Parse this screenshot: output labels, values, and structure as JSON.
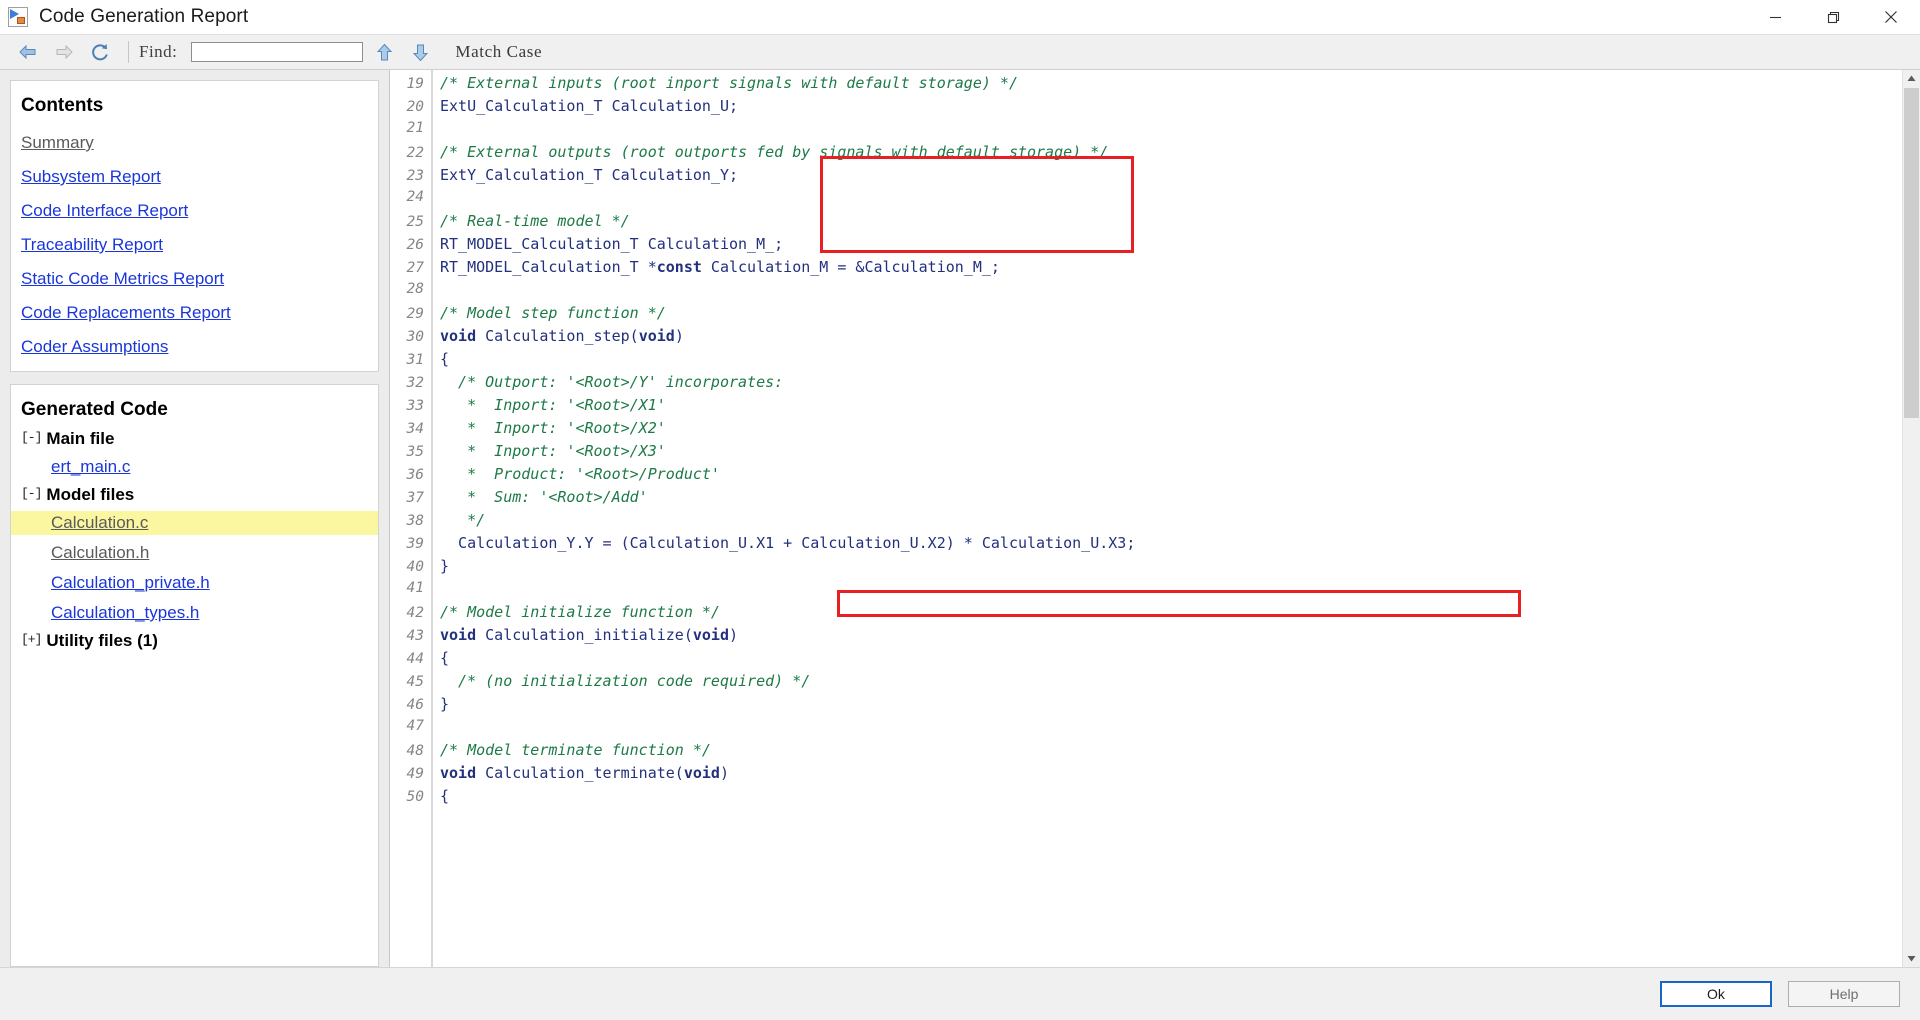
{
  "window": {
    "title": "Code Generation Report",
    "icon": "code-report-icon",
    "minimize_label": "Minimize",
    "restore_label": "Restore",
    "close_label": "Close"
  },
  "toolbar": {
    "back_label": "Back",
    "forward_label": "Forward",
    "reload_label": "Reload",
    "find_label": "Find:",
    "find_value": "",
    "find_placeholder": "",
    "find_prev_label": "Find Previous",
    "find_next_label": "Find Next",
    "match_case_label": "Match Case"
  },
  "sidebar": {
    "contents": {
      "title": "Contents",
      "links": [
        {
          "label": "Summary",
          "state": "visited"
        },
        {
          "label": "Subsystem Report",
          "state": "link"
        },
        {
          "label": "Code Interface Report",
          "state": "link"
        },
        {
          "label": "Traceability Report",
          "state": "link"
        },
        {
          "label": "Static Code Metrics Report",
          "state": "link"
        },
        {
          "label": "Code Replacements Report",
          "state": "link"
        },
        {
          "label": "Coder Assumptions",
          "state": "link"
        }
      ]
    },
    "generated_code": {
      "title": "Generated Code",
      "groups": [
        {
          "toggle": "[-]",
          "label": "Main file",
          "expanded": true,
          "files": [
            {
              "label": "ert_main.c",
              "state": "link"
            }
          ]
        },
        {
          "toggle": "[-]",
          "label": "Model files",
          "expanded": true,
          "files": [
            {
              "label": "Calculation.c",
              "state": "selected"
            },
            {
              "label": "Calculation.h",
              "state": "visited"
            },
            {
              "label": "Calculation_private.h",
              "state": "link"
            },
            {
              "label": "Calculation_types.h",
              "state": "link"
            }
          ]
        },
        {
          "toggle": "[+]",
          "label": "Utility files (1)",
          "expanded": false,
          "files": []
        }
      ]
    }
  },
  "code": {
    "file": "Calculation.c",
    "first_visible_line": 19,
    "lines": [
      {
        "n": 19,
        "segments": [
          {
            "t": "/* External inputs (root inport signals with default storage) */",
            "c": "cm"
          }
        ]
      },
      {
        "n": 20,
        "segments": [
          {
            "t": "ExtU_Calculation_T Calculation_U;",
            "c": "code"
          }
        ]
      },
      {
        "n": 21,
        "segments": [
          {
            "t": "",
            "c": "code"
          }
        ]
      },
      {
        "n": 22,
        "segments": [
          {
            "t": "/* External outputs (root outports fed by signals with default storage) */",
            "c": "cm"
          }
        ]
      },
      {
        "n": 23,
        "segments": [
          {
            "t": "ExtY_Calculation_T Calculation_Y;",
            "c": "code"
          }
        ]
      },
      {
        "n": 24,
        "segments": [
          {
            "t": "",
            "c": "code"
          }
        ]
      },
      {
        "n": 25,
        "segments": [
          {
            "t": "/* Real-time model */",
            "c": "cm"
          }
        ]
      },
      {
        "n": 26,
        "segments": [
          {
            "t": "RT_MODEL_Calculation_T Calculation_M_;",
            "c": "code"
          }
        ]
      },
      {
        "n": 27,
        "segments": [
          {
            "t": "RT_MODEL_Calculation_T *",
            "c": "code"
          },
          {
            "t": "const",
            "c": "kw"
          },
          {
            "t": " Calculation_M = &Calculation_M_;",
            "c": "code"
          }
        ]
      },
      {
        "n": 28,
        "segments": [
          {
            "t": "",
            "c": "code"
          }
        ]
      },
      {
        "n": 29,
        "segments": [
          {
            "t": "/* Model step function */",
            "c": "cm"
          }
        ]
      },
      {
        "n": 30,
        "segments": [
          {
            "t": "void",
            "c": "kw"
          },
          {
            "t": " Calculation_step(",
            "c": "code"
          },
          {
            "t": "void",
            "c": "kw"
          },
          {
            "t": ")",
            "c": "code"
          }
        ]
      },
      {
        "n": 31,
        "segments": [
          {
            "t": "{",
            "c": "code"
          }
        ]
      },
      {
        "n": 32,
        "segments": [
          {
            "t": "  /* Outport: '<Root>/Y' incorporates:",
            "c": "cm"
          }
        ]
      },
      {
        "n": 33,
        "segments": [
          {
            "t": "   *  Inport: '<Root>/X1'",
            "c": "cm"
          }
        ]
      },
      {
        "n": 34,
        "segments": [
          {
            "t": "   *  Inport: '<Root>/X2'",
            "c": "cm"
          }
        ]
      },
      {
        "n": 35,
        "segments": [
          {
            "t": "   *  Inport: '<Root>/X3'",
            "c": "cm"
          }
        ]
      },
      {
        "n": 36,
        "segments": [
          {
            "t": "   *  Product: '<Root>/Product'",
            "c": "cm"
          }
        ]
      },
      {
        "n": 37,
        "segments": [
          {
            "t": "   *  Sum: '<Root>/Add'",
            "c": "cm"
          }
        ]
      },
      {
        "n": 38,
        "segments": [
          {
            "t": "   */",
            "c": "cm"
          }
        ]
      },
      {
        "n": 39,
        "segments": [
          {
            "t": "  Calculation_Y.Y = (Calculation_U.X1 + Calculation_U.X2) * Calculation_U.X3;",
            "c": "code"
          }
        ]
      },
      {
        "n": 40,
        "segments": [
          {
            "t": "}",
            "c": "code"
          }
        ]
      },
      {
        "n": 41,
        "segments": [
          {
            "t": "",
            "c": "code"
          }
        ]
      },
      {
        "n": 42,
        "segments": [
          {
            "t": "/* Model initialize function */",
            "c": "cm"
          }
        ]
      },
      {
        "n": 43,
        "segments": [
          {
            "t": "void",
            "c": "kw"
          },
          {
            "t": " Calculation_initialize(",
            "c": "code"
          },
          {
            "t": "void",
            "c": "kw"
          },
          {
            "t": ")",
            "c": "code"
          }
        ]
      },
      {
        "n": 44,
        "segments": [
          {
            "t": "{",
            "c": "code"
          }
        ]
      },
      {
        "n": 45,
        "segments": [
          {
            "t": "  /* (no initialization code required) */",
            "c": "cm"
          }
        ]
      },
      {
        "n": 46,
        "segments": [
          {
            "t": "}",
            "c": "code"
          }
        ]
      },
      {
        "n": 47,
        "segments": [
          {
            "t": "",
            "c": "code"
          }
        ]
      },
      {
        "n": 48,
        "segments": [
          {
            "t": "/* Model terminate function */",
            "c": "cm"
          }
        ]
      },
      {
        "n": 49,
        "segments": [
          {
            "t": "void",
            "c": "kw"
          },
          {
            "t": " Calculation_terminate(",
            "c": "code"
          },
          {
            "t": "void",
            "c": "kw"
          },
          {
            "t": ")",
            "c": "code"
          }
        ]
      },
      {
        "n": 50,
        "segments": [
          {
            "t": "{",
            "c": "code"
          }
        ]
      }
    ],
    "annotations": [
      {
        "name": "external-io-declarations-highlight",
        "color": "#e81f23",
        "covers_lines": [
          20,
          23
        ]
      },
      {
        "name": "output-equation-highlight",
        "color": "#e81f23",
        "covers_lines": [
          39,
          39
        ]
      }
    ]
  },
  "footer": {
    "ok_label": "Ok",
    "help_label": "Help"
  },
  "colors": {
    "link": "#1a36d8",
    "visited_link": "#5a5a5a",
    "comment": "#1d7a46",
    "code": "#22307d",
    "highlight_row": "#fbf7a0",
    "annotation": "#e81f23",
    "accent_button": "#1667c8"
  }
}
